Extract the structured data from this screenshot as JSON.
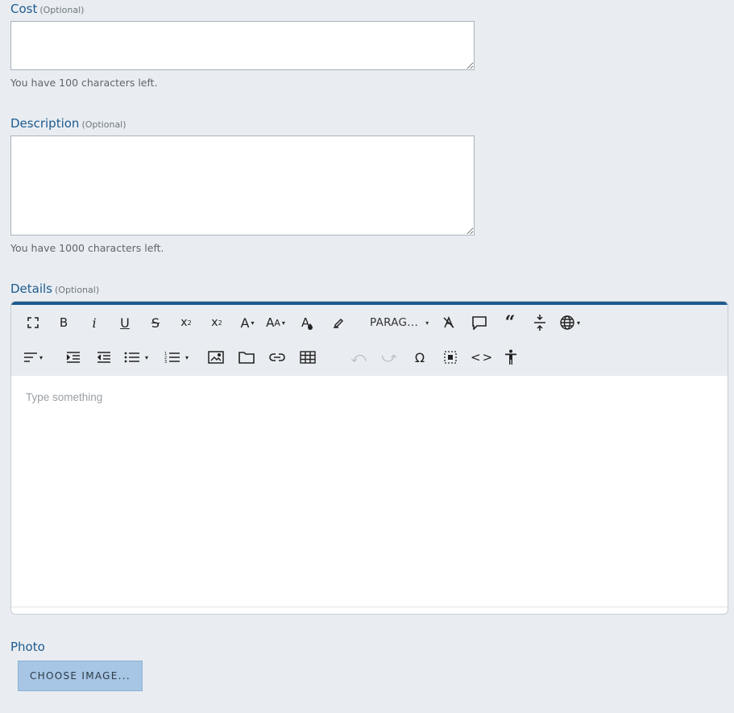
{
  "cost": {
    "label": "Cost",
    "optional": "(Optional)",
    "value": "",
    "help": "You have 100 characters left."
  },
  "description": {
    "label": "Description",
    "optional": "(Optional)",
    "value": "",
    "help": "You have 1000 characters left."
  },
  "details": {
    "label": "Details",
    "optional": "(Optional)",
    "placeholder": "Type something",
    "paragraph_label": "PARAG...",
    "toolbar_icons_row1": [
      "fullscreen-icon",
      "bold-icon",
      "italic-icon",
      "underline-icon",
      "strikethrough-icon",
      "subscript-icon",
      "superscript-icon",
      "font-family-icon",
      "font-size-icon",
      "font-color-icon",
      "highlight-icon",
      "paragraph-format",
      "clear-formatting-icon",
      "comment-icon",
      "blockquote-icon",
      "horizontal-line-icon",
      "language-icon"
    ],
    "toolbar_icons_row2": [
      "align-icon",
      "indent-icon",
      "outdent-icon",
      "bulleted-list-icon",
      "numbered-list-icon",
      "insert-image-icon",
      "insert-file-icon",
      "insert-link-icon",
      "insert-table-icon",
      "undo-icon",
      "redo-icon",
      "special-characters-icon",
      "select-all-icon",
      "code-view-icon",
      "accessibility-icon"
    ]
  },
  "photo": {
    "label": "Photo",
    "button": "CHOOSE IMAGE..."
  },
  "colors": {
    "accent": "#1d5a8e",
    "background": "#e9edf1",
    "button_bg": "#a7c5e4"
  }
}
